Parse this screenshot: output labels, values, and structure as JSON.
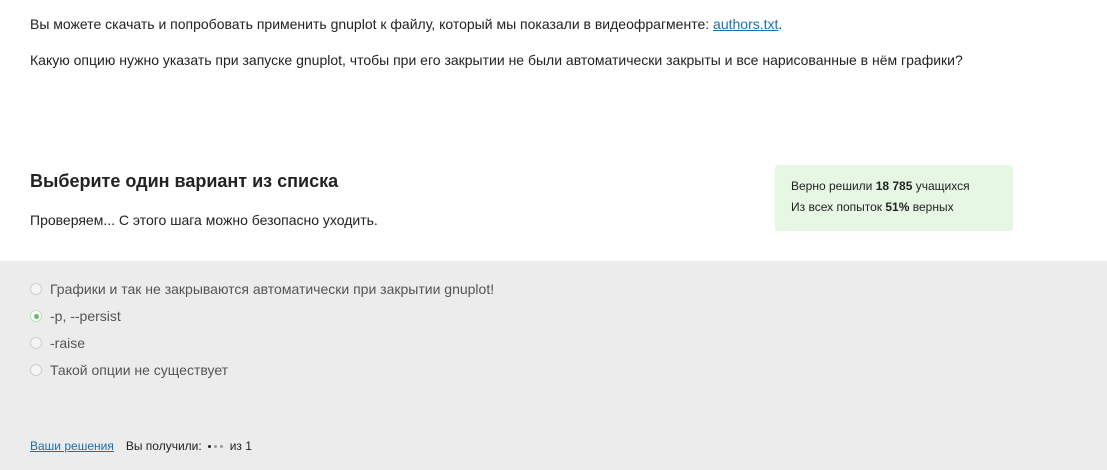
{
  "intro": {
    "paragraph1_text": "Вы можете скачать и попробовать применить gnuplot к файлу, который мы показали в видеофрагменте: ",
    "file_link": "authors.txt",
    "paragraph1_end": ".",
    "question": "Какую опцию нужно указать при запуске gnuplot, чтобы при его закрытии не были автоматически закрыты и все нарисованные в нём графики?"
  },
  "quiz": {
    "title": "Выберите один вариант из списка",
    "status": "Проверяем... С этого шага можно безопасно уходить."
  },
  "stats": {
    "solved_prefix": "Верно решили ",
    "solved_count": "18 785",
    "solved_suffix": " учащихся",
    "attempts_prefix": "Из всех попыток ",
    "attempts_percent": "51%",
    "attempts_suffix": " верных",
    "background_color": "#e6f7e4"
  },
  "options": [
    {
      "label": "Графики и так не закрываются автоматически при закрытии gnuplot!",
      "selected": false
    },
    {
      "label": "-p, --persist",
      "selected": true
    },
    {
      "label": "-raise",
      "selected": false
    },
    {
      "label": "Такой опции не существует",
      "selected": false
    }
  ],
  "footer": {
    "solutions_link": "Ваши решения",
    "received_label": "Вы получили:",
    "score_suffix": "из 1"
  },
  "colors": {
    "link": "#1b6fb3",
    "panel_background": "#ececec",
    "selected_radio": "#66bb6a"
  }
}
